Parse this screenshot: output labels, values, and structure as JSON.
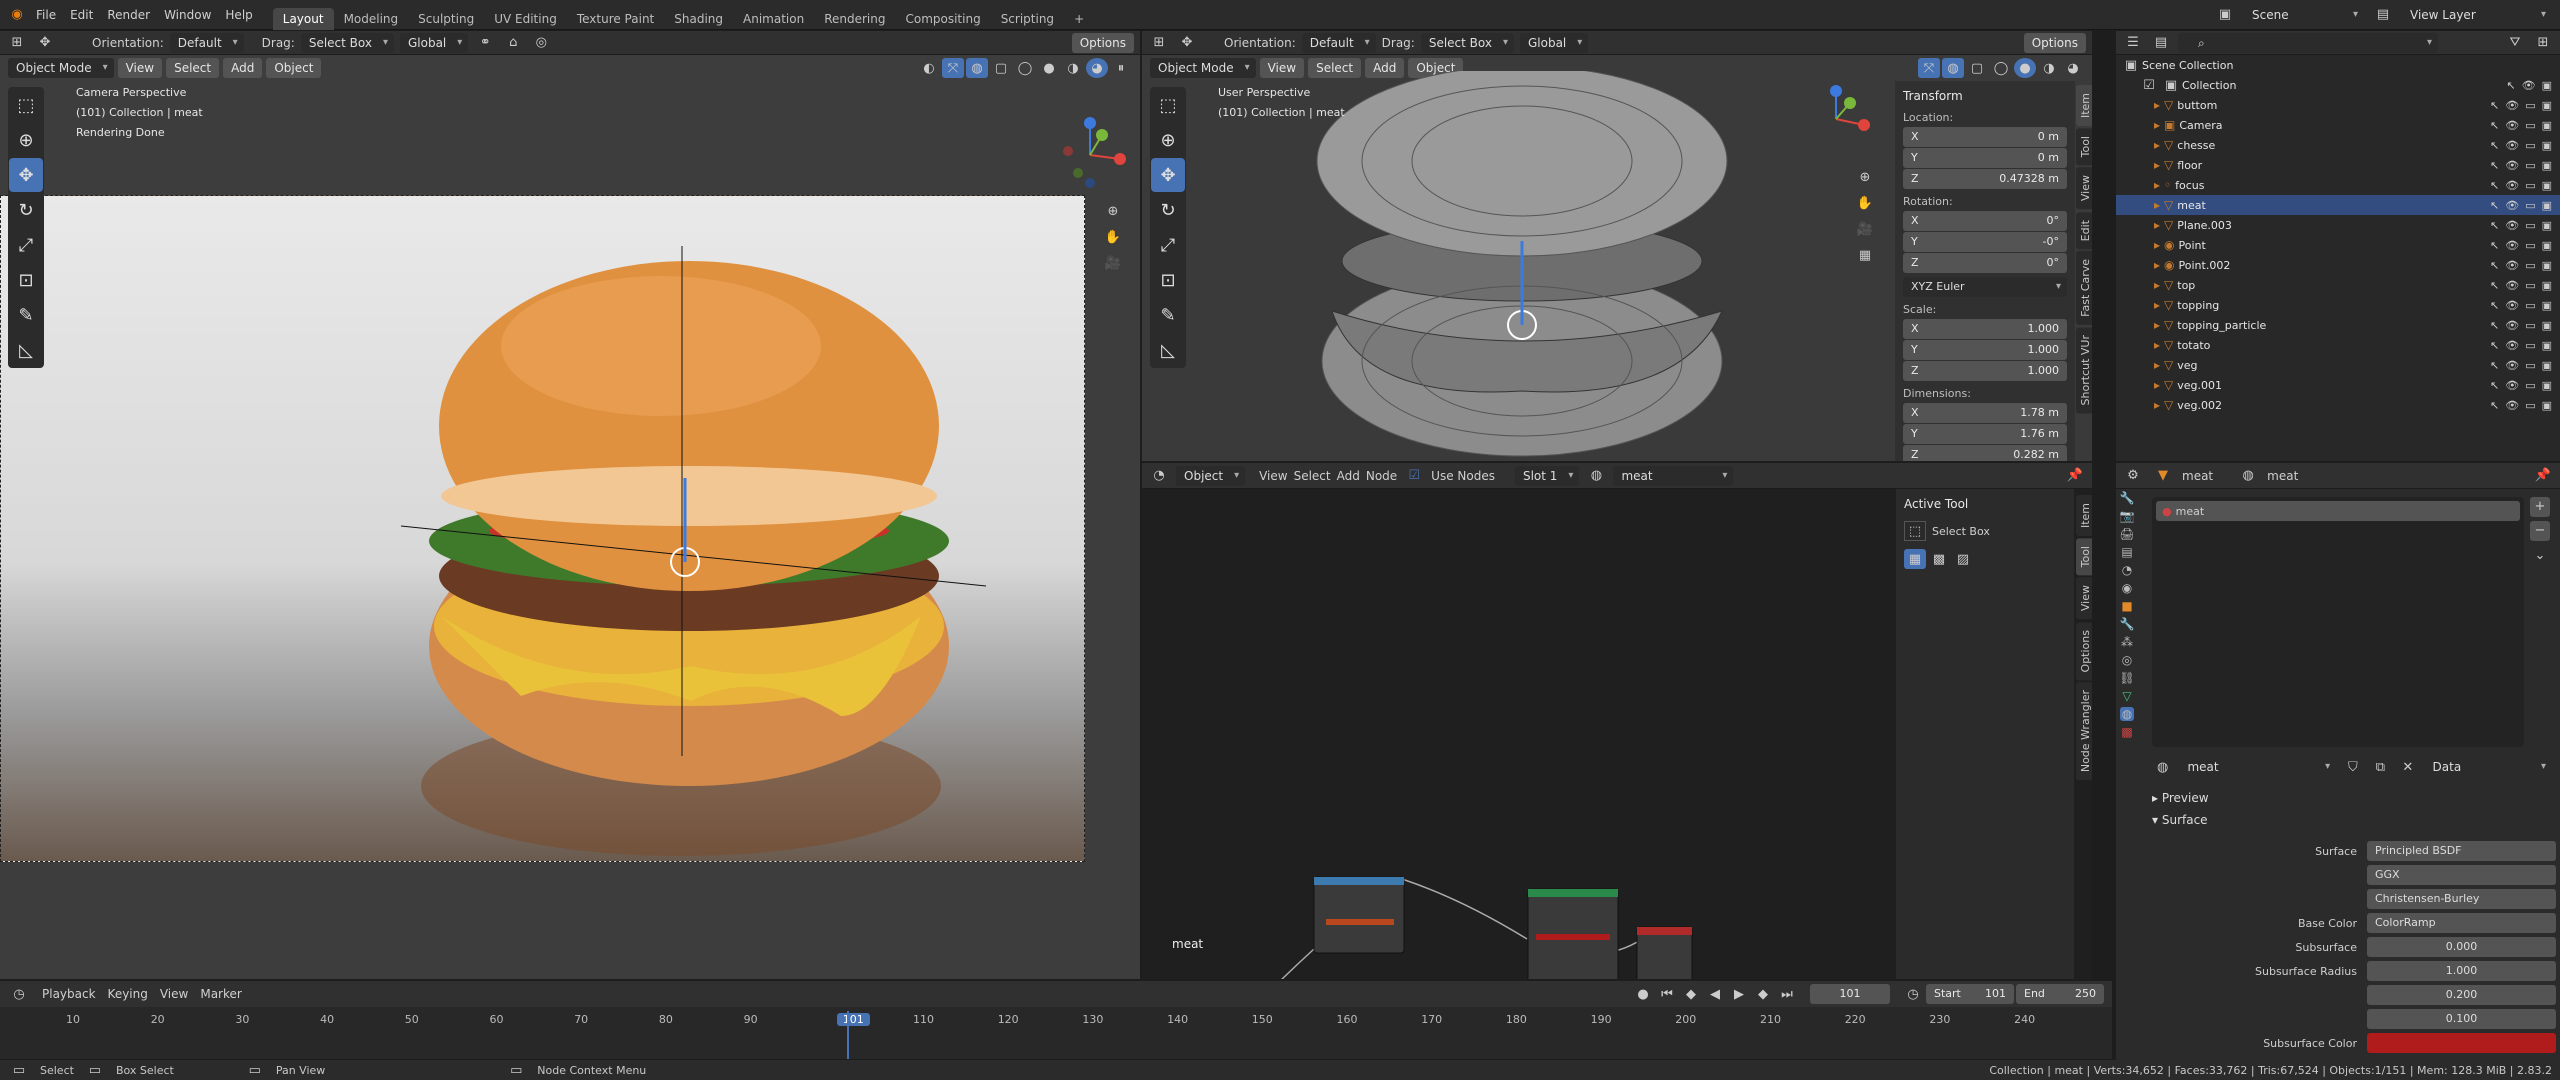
{
  "topbar": {
    "menus": [
      "File",
      "Edit",
      "Render",
      "Window",
      "Help"
    ],
    "workspaces": [
      "Layout",
      "Modeling",
      "Sculpting",
      "UV Editing",
      "Texture Paint",
      "Shading",
      "Animation",
      "Rendering",
      "Compositing",
      "Scripting",
      "+"
    ],
    "scene": "Scene",
    "view_layer": "View Layer"
  },
  "left_viewport": {
    "orientation_label": "Orientation:",
    "orientation_value": "Default",
    "drag_label": "Drag:",
    "drag_value": "Select Box",
    "transform_value": "Global",
    "options": "Options",
    "mode": "Object Mode",
    "menu": [
      "View",
      "Select",
      "Add",
      "Object"
    ],
    "overlay": [
      "Camera Perspective",
      "(101) Collection | meat",
      "Rendering Done"
    ]
  },
  "right_viewport": {
    "orientation_label": "Orientation:",
    "orientation_value": "Default",
    "drag_label": "Drag:",
    "drag_value": "Select Box",
    "transform_value": "Global",
    "options": "Options",
    "mode": "Object Mode",
    "menu": [
      "View",
      "Select",
      "Add",
      "Object"
    ],
    "overlay": [
      "User Perspective",
      "(101) Collection | meat"
    ],
    "npanel": {
      "title": "Transform",
      "location_label": "Location:",
      "location": [
        {
          "axis": "X",
          "value": "0 m"
        },
        {
          "axis": "Y",
          "value": "0 m"
        },
        {
          "axis": "Z",
          "value": "0.47328 m"
        }
      ],
      "rotation_label": "Rotation:",
      "rotation": [
        {
          "axis": "X",
          "value": "0°"
        },
        {
          "axis": "Y",
          "value": "-0°"
        },
        {
          "axis": "Z",
          "value": "0°"
        }
      ],
      "rotation_mode": "XYZ Euler",
      "scale_label": "Scale:",
      "scale": [
        {
          "axis": "X",
          "value": "1.000"
        },
        {
          "axis": "Y",
          "value": "1.000"
        },
        {
          "axis": "Z",
          "value": "1.000"
        }
      ],
      "dimensions_label": "Dimensions:",
      "dimensions": [
        {
          "axis": "X",
          "value": "1.78 m"
        },
        {
          "axis": "Y",
          "value": "1.76 m"
        },
        {
          "axis": "Z",
          "value": "0.282 m"
        }
      ]
    },
    "tabs": [
      "Item",
      "Tool",
      "View",
      "Edit",
      "Fast Carve",
      "Shortcut VUr"
    ]
  },
  "node_editor": {
    "type": "Object",
    "menu": [
      "View",
      "Select",
      "Add",
      "Node"
    ],
    "use_nodes": "Use Nodes",
    "slot": "Slot 1",
    "material": "meat",
    "active_tool_title": "Active Tool",
    "active_tool_name": "Select Box",
    "material_label": "meat",
    "tabs": [
      "Item",
      "Tool",
      "View",
      "Options",
      "Node Wrangler"
    ]
  },
  "outliner": {
    "root": "Scene Collection",
    "collection": "Collection",
    "items": [
      {
        "name": "buttom",
        "selected": false
      },
      {
        "name": "Camera",
        "selected": false
      },
      {
        "name": "chesse",
        "selected": false
      },
      {
        "name": "floor",
        "selected": false
      },
      {
        "name": "focus",
        "selected": false
      },
      {
        "name": "meat",
        "selected": true
      },
      {
        "name": "Plane.003",
        "selected": false
      },
      {
        "name": "Point",
        "selected": false
      },
      {
        "name": "Point.002",
        "selected": false
      },
      {
        "name": "top",
        "selected": false
      },
      {
        "name": "topping",
        "selected": false
      },
      {
        "name": "topping_particle",
        "selected": false
      },
      {
        "name": "totato",
        "selected": false
      },
      {
        "name": "veg",
        "selected": false
      },
      {
        "name": "veg.001",
        "selected": false
      },
      {
        "name": "veg.002",
        "selected": false
      }
    ]
  },
  "properties": {
    "breadcrumb_object": "meat",
    "breadcrumb_material": "meat",
    "slot_item": "meat",
    "material_name": "meat",
    "data_dropdown": "Data",
    "preview": "Preview",
    "surface_section": "Surface",
    "rows": [
      {
        "label": "Surface",
        "value": "Principled BSDF",
        "kind": "dropdown"
      },
      {
        "label": "",
        "value": "GGX",
        "kind": "dropdown"
      },
      {
        "label": "",
        "value": "Christensen-Burley",
        "kind": "dropdown"
      },
      {
        "label": "Base Color",
        "value": "ColorRamp",
        "kind": "link"
      },
      {
        "label": "Subsurface",
        "value": "0.000",
        "kind": "number"
      },
      {
        "label": "Subsurface Radius",
        "value": "1.000",
        "kind": "number"
      },
      {
        "label": "",
        "value": "0.200",
        "kind": "number"
      },
      {
        "label": "",
        "value": "0.100",
        "kind": "number"
      }
    ],
    "subsurface_color_label": "Subsurface Color",
    "subsurface_color": "#b01c1c"
  },
  "timeline": {
    "menu": [
      "Playback",
      "Keying",
      "View",
      "Marker"
    ],
    "current_frame": "101",
    "start_label": "Start",
    "start": "101",
    "end_label": "End",
    "end": "250",
    "ticks": [
      "10",
      "20",
      "30",
      "40",
      "50",
      "60",
      "70",
      "80",
      "90",
      "101",
      "110",
      "120",
      "130",
      "140",
      "150",
      "160",
      "170",
      "180",
      "190",
      "200",
      "210",
      "220",
      "230",
      "240"
    ]
  },
  "statusbar": {
    "select": "Select",
    "box_select": "Box Select",
    "pan_view": "Pan View",
    "context": "Node Context Menu",
    "stats": "Collection | meat | Verts:34,652 | Faces:33,762 | Tris:67,524 | Objects:1/151 | Mem: 128.3 MiB | 2.83.2"
  },
  "colors": {
    "accent": "#4772b3",
    "selected_row": "#334d80",
    "header": "#303030"
  }
}
